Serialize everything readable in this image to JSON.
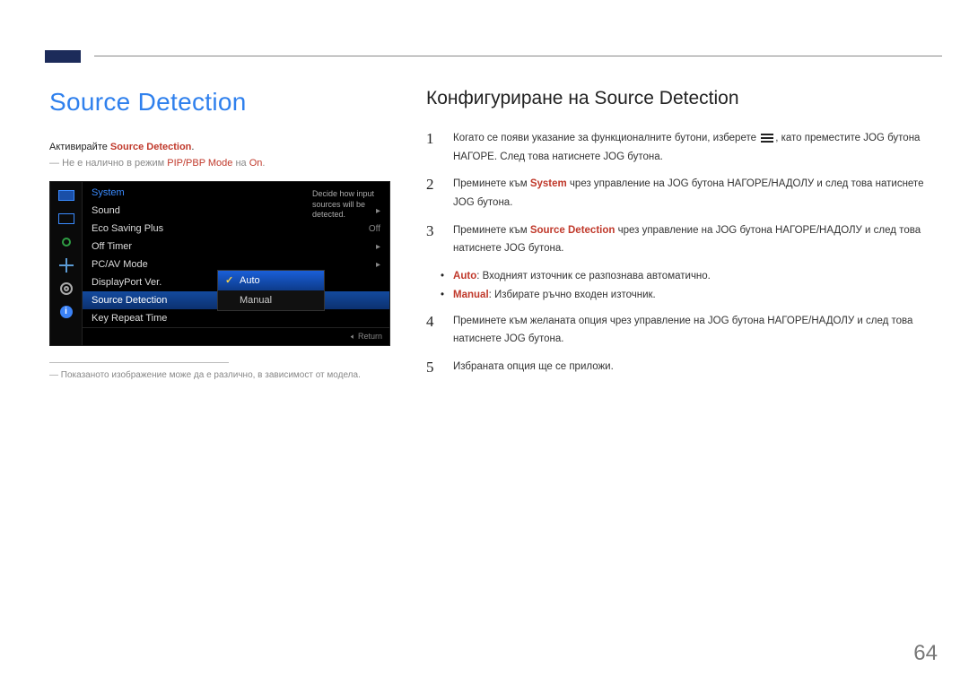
{
  "title_left": "Source Detection",
  "activate_prefix": "Активирайте ",
  "activate_emphasis": "Source Detection",
  "activate_suffix": ".",
  "unavailable_prefix": "Не е налично в режим ",
  "unavailable_red": "PIP/PBP Mode",
  "unavailable_mid": " на ",
  "unavailable_on": "On",
  "unavailable_end": ".",
  "osd": {
    "header": "System",
    "hint": "Decide how input sources will be detected.",
    "rows": {
      "sound": {
        "label": "Sound",
        "right": "▸"
      },
      "eco": {
        "label": "Eco Saving Plus",
        "right": "Off"
      },
      "timer": {
        "label": "Off Timer",
        "right": "▸"
      },
      "pcav": {
        "label": "PC/AV Mode",
        "right": "▸"
      },
      "dpver": {
        "label": "DisplayPort Ver.",
        "right": ""
      },
      "srcdet": {
        "label": "Source Detection",
        "right": ""
      },
      "keyrep": {
        "label": "Key Repeat Time",
        "right": ""
      }
    },
    "popup": {
      "auto": "Auto",
      "manual": "Manual"
    },
    "return": "Return"
  },
  "model_note": "Показаното изображение може да е различно, в зависимост от модела.",
  "title_right": "Конфигуриране на Source Detection",
  "steps": {
    "s1_a": "Когато се появи указание за функционалните бутони, изберете ",
    "s1_b": ", като преместите JOG бутона НАГОРЕ. След това натиснете JOG бутона.",
    "s2_a": "Преминете към ",
    "s2_sys": "System",
    "s2_b": " чрез управление на JOG бутона НАГОРЕ/НАДОЛУ и след това натиснете JOG бутона.",
    "s3_a": "Преминете към ",
    "s3_sd": "Source Detection",
    "s3_b": " чрез управление на JOG бутона НАГОРЕ/НАДОЛУ и след това натиснете JOG бутона.",
    "b_auto_lbl": "Auto",
    "b_auto_txt": ": Входният източник се разпознава автоматично.",
    "b_man_lbl": "Manual",
    "b_man_txt": ": Избирате ръчно входен източник.",
    "s4": "Преминете към желаната опция чрез управление на JOG бутона НАГОРЕ/НАДОЛУ и след това натиснете JOG бутона.",
    "s5": "Избраната опция ще се приложи."
  },
  "nums": {
    "n1": "1",
    "n2": "2",
    "n3": "3",
    "n4": "4",
    "n5": "5"
  },
  "page_number": "64"
}
